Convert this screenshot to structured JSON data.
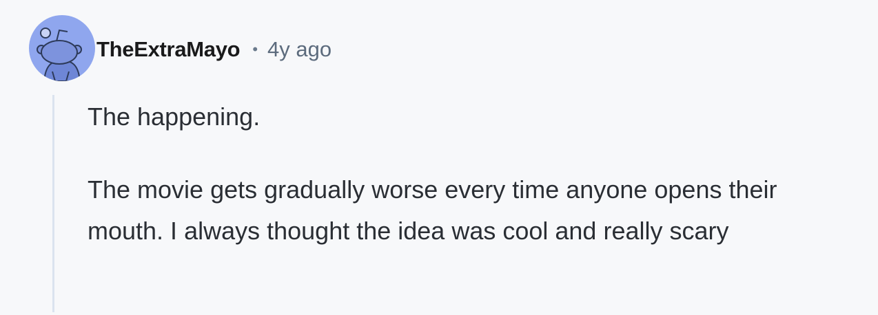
{
  "comment": {
    "username": "TheExtraMayo",
    "separator": "•",
    "timestamp": "4y ago",
    "avatar_icon": "snoo-avatar-icon",
    "avatar_color": "#8fa6ee",
    "paragraphs": [
      "The happening.",
      "The movie gets gradually worse every time anyone opens their mouth. I always thought the idea was cool and really scary"
    ]
  }
}
